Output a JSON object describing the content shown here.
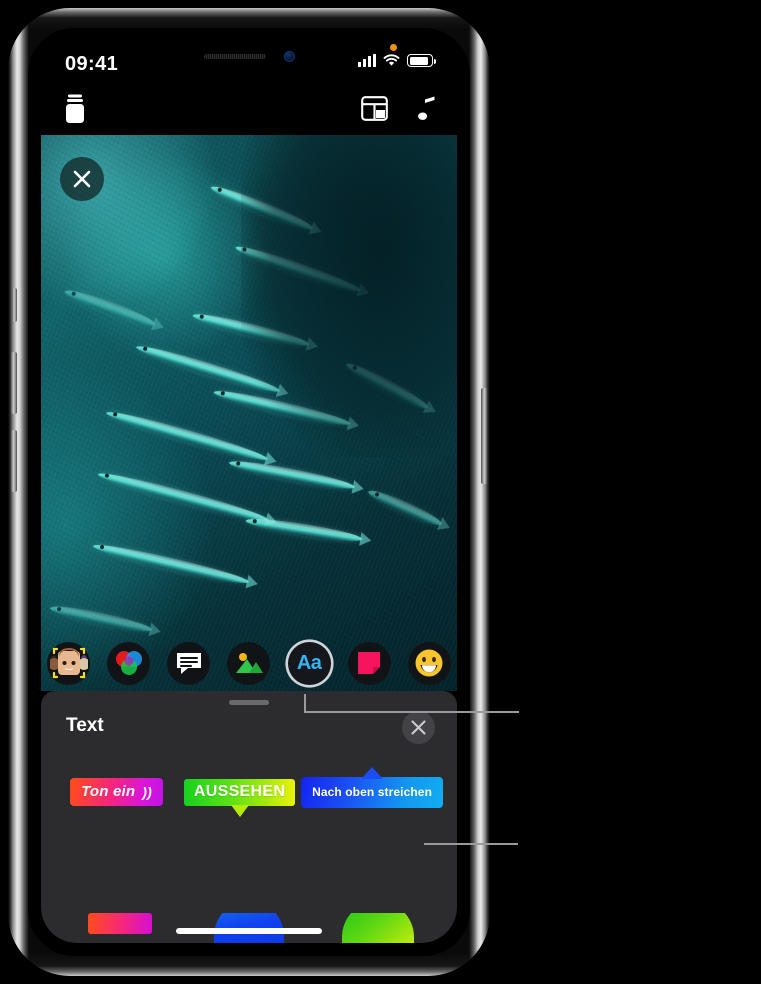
{
  "device": {
    "name": "iphone-x-frame",
    "buttons": [
      "silent-switch",
      "volume-up",
      "volume-down",
      "side-button"
    ]
  },
  "status_bar": {
    "time": "09:41",
    "orange_dot": "microphone-in-use-indicator",
    "cellular_icon": "cellular-bars-icon",
    "cellular_bars": 4,
    "wifi_icon": "wifi-icon",
    "battery_icon": "battery-icon",
    "battery_level_pct": 90
  },
  "app_topbar": {
    "camera_roll_label": "camera-roll-icon",
    "app_drawer_label": "app-drawer-icon",
    "music_label": "music-note-icon"
  },
  "media": {
    "type": "photo",
    "description": "school of fish underwater",
    "close_label": "✕"
  },
  "effects_toolbar": {
    "items": [
      {
        "name": "memoji",
        "icon": "memoji-icon",
        "selected": false
      },
      {
        "name": "effects",
        "icon": "color-filters-icon",
        "selected": false
      },
      {
        "name": "labels",
        "icon": "speech-bubble-icon",
        "selected": false
      },
      {
        "name": "photos",
        "icon": "photo-library-icon",
        "selected": false
      },
      {
        "name": "text",
        "icon": "text-aa-icon",
        "label": "Aa",
        "selected": true
      },
      {
        "name": "stickers",
        "icon": "sticker-icon",
        "selected": false
      },
      {
        "name": "emoji",
        "icon": "emoji-icon",
        "label": "😀",
        "selected": false
      }
    ]
  },
  "sheet": {
    "title": "Text",
    "close_label": "✕",
    "grabber": "sheet-grabber",
    "styles": [
      {
        "label": "Ton ein",
        "trailing_icon": "))",
        "kind": "sound-badge",
        "colors": {
          "from": "#ff4d18",
          "to": "#c113e8"
        }
      },
      {
        "label": "AUSSEHEN",
        "kind": "speech-bubble",
        "colors": {
          "from": "#17d11f",
          "to": "#e8f20a"
        }
      },
      {
        "label": "Nach oben streichen",
        "kind": "swipe-up-badge",
        "colors": {
          "from": "#1324f0",
          "to": "#12aef2"
        }
      }
    ],
    "styles_row2": [
      {
        "kind": "chip-pink",
        "colors": {
          "from": "#ff4d18",
          "to": "#d40fd4"
        }
      },
      {
        "kind": "chip-blue",
        "colors": {
          "from": "#1176f2",
          "to": "#0f3ae8"
        }
      },
      {
        "kind": "chip-green",
        "colors": {
          "from": "#1ec41a",
          "to": "#c8ec0c"
        }
      }
    ]
  },
  "callouts": {
    "leader_1": "points-to-text-effect-button",
    "leader_2": "points-to-swipe-up-text-style"
  },
  "colors": {
    "background": "#000000",
    "sheet_background": "#2c2c2e",
    "accent_blue": "#36b4f5",
    "selection_ring": "#cfd4d8"
  }
}
